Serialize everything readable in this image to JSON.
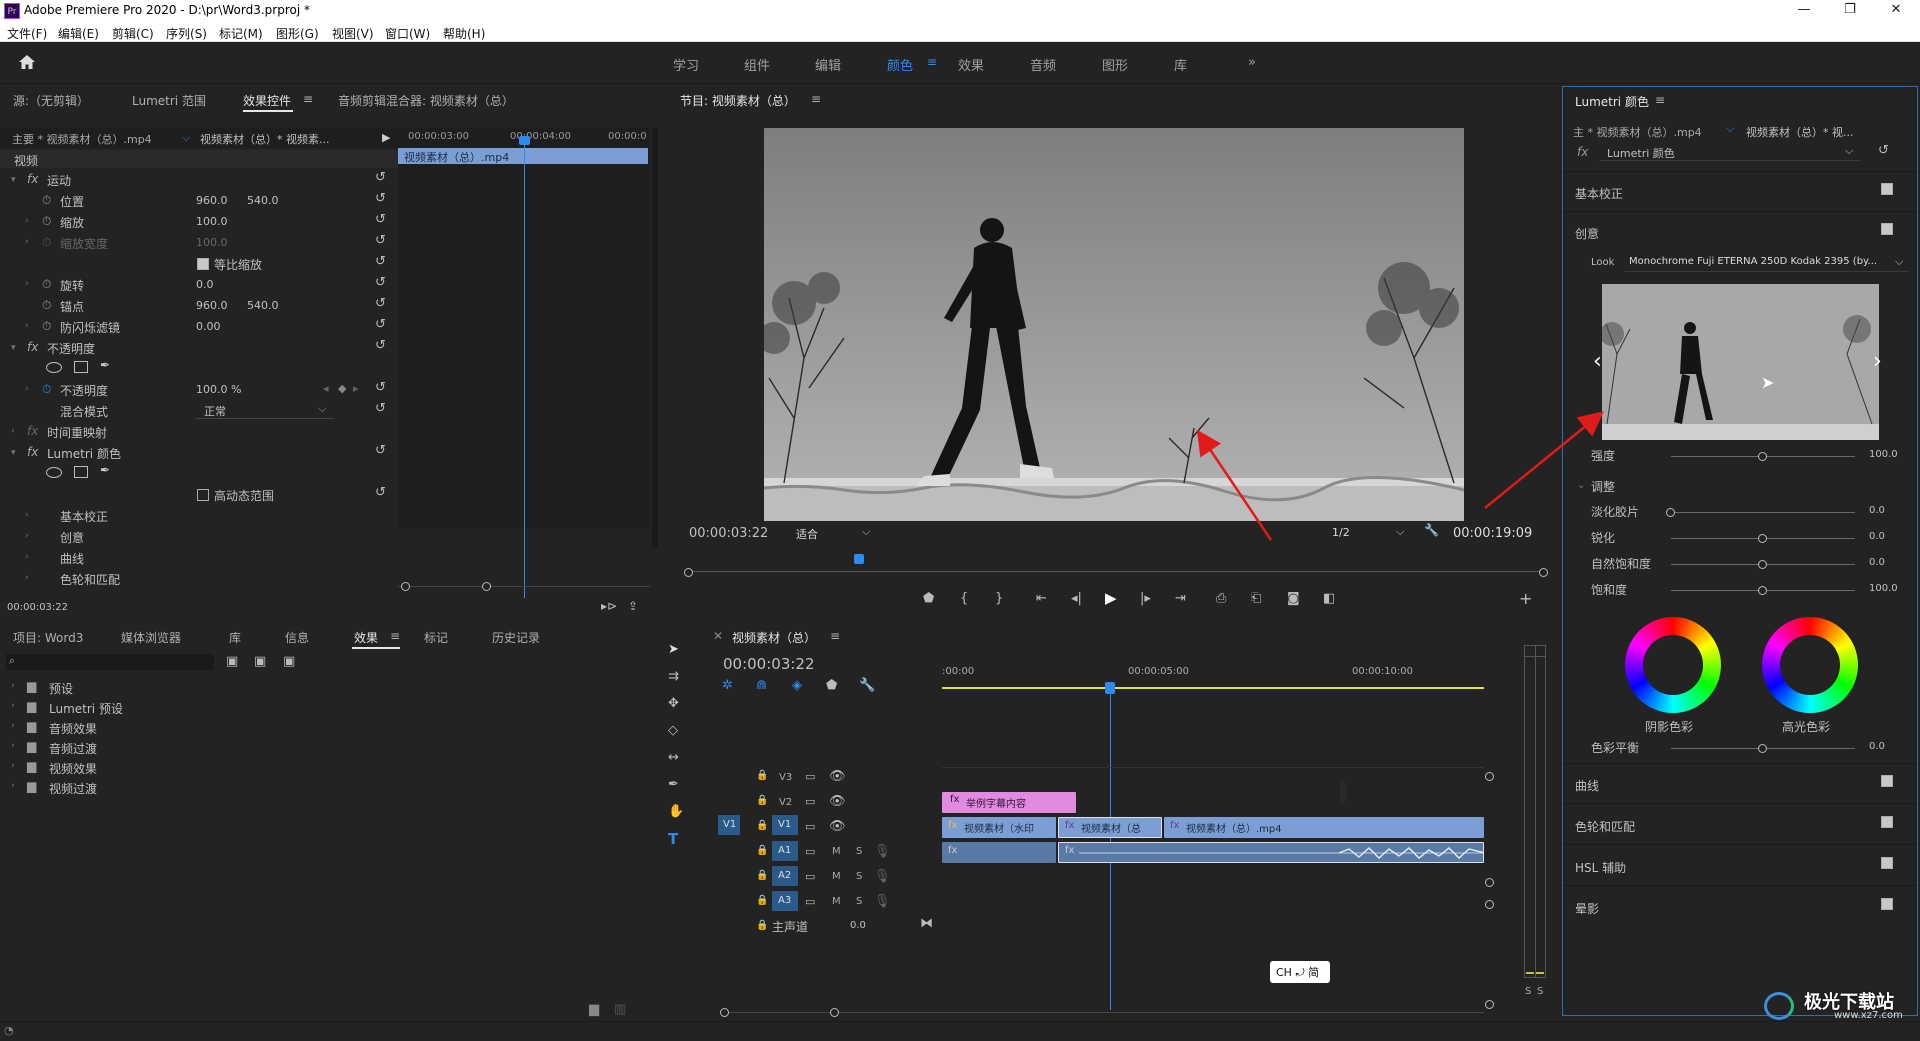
{
  "app": {
    "title": "Adobe Premiere Pro 2020 - D:\\pr\\Word3.prproj *",
    "logo_text": "Pr",
    "menu": [
      "文件(F)",
      "编辑(E)",
      "剪辑(C)",
      "序列(S)",
      "标记(M)",
      "图形(G)",
      "视图(V)",
      "窗口(W)",
      "帮助(H)"
    ]
  },
  "workspaces": {
    "items": [
      "学习",
      "组件",
      "编辑",
      "颜色",
      "效果",
      "音频",
      "图形",
      "库"
    ],
    "active": "颜色",
    "more": "»"
  },
  "source_panel": {
    "tabs": [
      "源:（无剪辑）",
      "Lumetri 范围",
      "效果控件",
      "音频剪辑混合器: 视频素材（总）"
    ],
    "master_label": "主要 * 视频素材（总）.mp4",
    "sequence_label": "视频素材（总）* 视频素...",
    "ruler": [
      "00:00:03:00",
      "00:00:04:00",
      "00:00:0"
    ],
    "clip": "视频素材（总）.mp4",
    "video_header": "视频",
    "rows": {
      "motion": "运动",
      "position": "位置",
      "position_x": "960.0",
      "position_y": "540.0",
      "scale": "缩放",
      "scale_v": "100.0",
      "scale_width": "缩放宽度",
      "scale_width_v": "100.0",
      "uniform_scale": "等比缩放",
      "rotation": "旋转",
      "rotation_v": "0.0",
      "anchor": "锚点",
      "anchor_x": "960.0",
      "anchor_y": "540.0",
      "flicker": "防闪烁滤镜",
      "flicker_v": "0.00",
      "opacity_group": "不透明度",
      "opacity": "不透明度",
      "opacity_v": "100.0 %",
      "blend": "混合模式",
      "blend_v": "正常",
      "time_remap": "时间重映射",
      "lumetri": "Lumetri 颜色",
      "hdr": "高动态范围",
      "basic": "基本校正",
      "creative": "创意",
      "curves": "曲线",
      "wheels": "色轮和匹配"
    },
    "timecode": "00:00:03:22"
  },
  "program": {
    "title": "节目: 视频素材（总）",
    "timecode": "00:00:03:22",
    "fit": "适合",
    "resolution": "1/2",
    "duration": "00:00:19:09",
    "playhead_fraction": 0.2
  },
  "lumetri": {
    "title": "Lumetri 颜色",
    "master": "主 * 视频素材（总）.mp4",
    "sequence": "视频素材（总）* 视...",
    "fx": "fx",
    "effect": "Lumetri 颜色",
    "basic": "基本校正",
    "creative": "创意",
    "look_label": "Look",
    "look_value": "Monochrome Fuji ETERNA 250D Kodak 2395 (by...",
    "intensity_label": "强度",
    "intensity": "100.0",
    "adjust": "调整",
    "sliders": [
      {
        "label": "淡化胶片",
        "value": "0.0",
        "fraction": 0.0
      },
      {
        "label": "锐化",
        "value": "0.0",
        "fraction": 0.5
      },
      {
        "label": "自然饱和度",
        "value": "0.0",
        "fraction": 0.5
      },
      {
        "label": "饱和度",
        "value": "100.0",
        "fraction": 0.5
      }
    ],
    "shadow_label": "阴影色彩",
    "highlight_label": "高光色彩",
    "balance_label": "色彩平衡",
    "balance": "0.0",
    "sections": [
      "曲线",
      "色轮和匹配",
      "HSL 辅助",
      "晕影"
    ]
  },
  "project": {
    "tabs": [
      "项目: Word3",
      "媒体浏览器",
      "库",
      "信息",
      "效果",
      "标记",
      "历史记录"
    ],
    "active": "效果",
    "search_placeholder": "",
    "folders": [
      "预设",
      "Lumetri 预设",
      "音频效果",
      "音频过渡",
      "视频效果",
      "视频过渡"
    ]
  },
  "timeline": {
    "title": "视频素材（总）",
    "timecode": "00:00:03:22",
    "ruler": [
      ":00:00",
      "00:00:05:00",
      "00:00:10:00"
    ],
    "video_tracks": [
      "V3",
      "V2",
      "V1"
    ],
    "audio_tracks": [
      "A1",
      "A2",
      "A3"
    ],
    "source_patch": "V1",
    "master": "主声道",
    "master_v": "0.0",
    "clips": {
      "title_clip": "举例字幕内容",
      "clip1": "视频素材（水印",
      "clip2": "视频素材（总",
      "clip3": "视频素材（总）.mp4"
    },
    "ime": "CH ⤾ 简",
    "meter_labels": [
      "S",
      "S"
    ]
  },
  "watermark": {
    "name": "极光下载站",
    "url": "www.xz7.com"
  },
  "colors": {
    "accent": "#2d8ceb",
    "clip_video": "#7b9fd4",
    "clip_title": "#e08ae0",
    "audio_clip": "#5a7aa6",
    "arrow": "#e11a1a"
  }
}
